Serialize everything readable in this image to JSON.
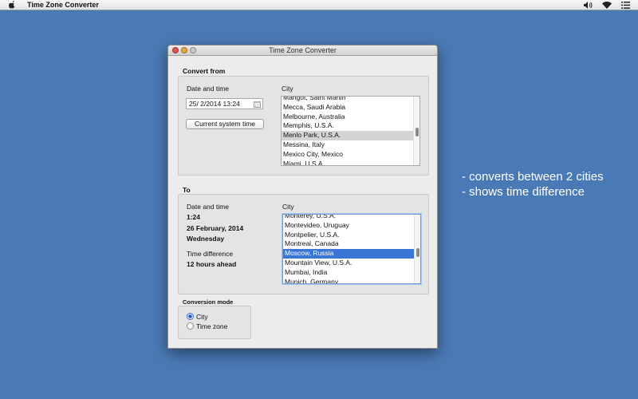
{
  "menubar": {
    "app_name": "Time Zone Converter"
  },
  "window": {
    "title": "Time Zone Converter"
  },
  "convert_from": {
    "section_title": "Convert from",
    "date_label": "Date and time",
    "date_value": "25/  2/2014 13:24",
    "current_time_button": "Current system time",
    "city_label": "City",
    "cities": [
      "Marigot, Saint Martin",
      "Mecca, Saudi Arabia",
      "Melbourne, Australia",
      "Memphis, U.S.A.",
      "Menlo Park, U.S.A.",
      "Messina, Italy",
      "Mexico City, Mexico",
      "Miami, U.S.A."
    ],
    "selected_city": "Menlo Park, U.S.A."
  },
  "to": {
    "section_title": "To",
    "date_label": "Date and time",
    "time_value": "1:24",
    "date_value": "26 February, 2014",
    "weekday_value": "Wednesday",
    "difference_label": "Time difference",
    "difference_value": "12 hours ahead",
    "city_label": "City",
    "cities": [
      "Monterey, U.S.A.",
      "Montevideo, Uruguay",
      "Montpelier, U.S.A.",
      "Montreal, Canada",
      "Moscow, Russia",
      "Mountain View, U.S.A.",
      "Mumbai, India",
      "Munich, Germany"
    ],
    "selected_city": "Moscow, Russia"
  },
  "conversion_mode": {
    "title": "Conversion mode",
    "options": [
      "City",
      "Time zone"
    ],
    "selected": "City"
  },
  "side_notes": {
    "line1": "- converts between 2 cities",
    "line2": "- shows time difference"
  },
  "colors": {
    "desktop": "#4a7ab5",
    "selection_blue": "#3b76d6",
    "selection_gray": "#d4d4d4"
  }
}
